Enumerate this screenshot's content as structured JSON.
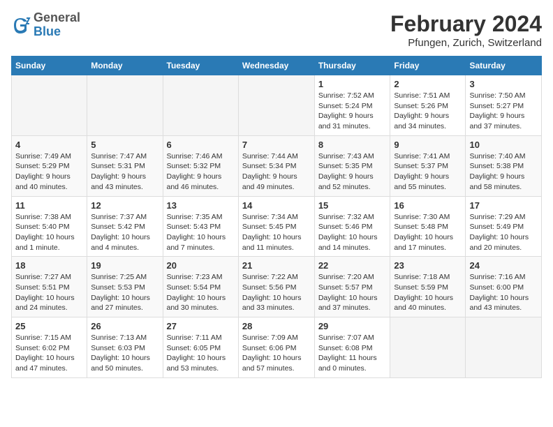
{
  "header": {
    "logo_line1": "General",
    "logo_line2": "Blue",
    "title": "February 2024",
    "subtitle": "Pfungen, Zurich, Switzerland"
  },
  "days_of_week": [
    "Sunday",
    "Monday",
    "Tuesday",
    "Wednesday",
    "Thursday",
    "Friday",
    "Saturday"
  ],
  "weeks": [
    [
      {
        "day": "",
        "sunrise": "",
        "sunset": "",
        "daylight": "",
        "empty": true
      },
      {
        "day": "",
        "sunrise": "",
        "sunset": "",
        "daylight": "",
        "empty": true
      },
      {
        "day": "",
        "sunrise": "",
        "sunset": "",
        "daylight": "",
        "empty": true
      },
      {
        "day": "",
        "sunrise": "",
        "sunset": "",
        "daylight": "",
        "empty": true
      },
      {
        "day": "1",
        "sunrise": "Sunrise: 7:52 AM",
        "sunset": "Sunset: 5:24 PM",
        "daylight": "Daylight: 9 hours and 31 minutes."
      },
      {
        "day": "2",
        "sunrise": "Sunrise: 7:51 AM",
        "sunset": "Sunset: 5:26 PM",
        "daylight": "Daylight: 9 hours and 34 minutes."
      },
      {
        "day": "3",
        "sunrise": "Sunrise: 7:50 AM",
        "sunset": "Sunset: 5:27 PM",
        "daylight": "Daylight: 9 hours and 37 minutes."
      }
    ],
    [
      {
        "day": "4",
        "sunrise": "Sunrise: 7:49 AM",
        "sunset": "Sunset: 5:29 PM",
        "daylight": "Daylight: 9 hours and 40 minutes."
      },
      {
        "day": "5",
        "sunrise": "Sunrise: 7:47 AM",
        "sunset": "Sunset: 5:31 PM",
        "daylight": "Daylight: 9 hours and 43 minutes."
      },
      {
        "day": "6",
        "sunrise": "Sunrise: 7:46 AM",
        "sunset": "Sunset: 5:32 PM",
        "daylight": "Daylight: 9 hours and 46 minutes."
      },
      {
        "day": "7",
        "sunrise": "Sunrise: 7:44 AM",
        "sunset": "Sunset: 5:34 PM",
        "daylight": "Daylight: 9 hours and 49 minutes."
      },
      {
        "day": "8",
        "sunrise": "Sunrise: 7:43 AM",
        "sunset": "Sunset: 5:35 PM",
        "daylight": "Daylight: 9 hours and 52 minutes."
      },
      {
        "day": "9",
        "sunrise": "Sunrise: 7:41 AM",
        "sunset": "Sunset: 5:37 PM",
        "daylight": "Daylight: 9 hours and 55 minutes."
      },
      {
        "day": "10",
        "sunrise": "Sunrise: 7:40 AM",
        "sunset": "Sunset: 5:38 PM",
        "daylight": "Daylight: 9 hours and 58 minutes."
      }
    ],
    [
      {
        "day": "11",
        "sunrise": "Sunrise: 7:38 AM",
        "sunset": "Sunset: 5:40 PM",
        "daylight": "Daylight: 10 hours and 1 minute."
      },
      {
        "day": "12",
        "sunrise": "Sunrise: 7:37 AM",
        "sunset": "Sunset: 5:42 PM",
        "daylight": "Daylight: 10 hours and 4 minutes."
      },
      {
        "day": "13",
        "sunrise": "Sunrise: 7:35 AM",
        "sunset": "Sunset: 5:43 PM",
        "daylight": "Daylight: 10 hours and 7 minutes."
      },
      {
        "day": "14",
        "sunrise": "Sunrise: 7:34 AM",
        "sunset": "Sunset: 5:45 PM",
        "daylight": "Daylight: 10 hours and 11 minutes."
      },
      {
        "day": "15",
        "sunrise": "Sunrise: 7:32 AM",
        "sunset": "Sunset: 5:46 PM",
        "daylight": "Daylight: 10 hours and 14 minutes."
      },
      {
        "day": "16",
        "sunrise": "Sunrise: 7:30 AM",
        "sunset": "Sunset: 5:48 PM",
        "daylight": "Daylight: 10 hours and 17 minutes."
      },
      {
        "day": "17",
        "sunrise": "Sunrise: 7:29 AM",
        "sunset": "Sunset: 5:49 PM",
        "daylight": "Daylight: 10 hours and 20 minutes."
      }
    ],
    [
      {
        "day": "18",
        "sunrise": "Sunrise: 7:27 AM",
        "sunset": "Sunset: 5:51 PM",
        "daylight": "Daylight: 10 hours and 24 minutes."
      },
      {
        "day": "19",
        "sunrise": "Sunrise: 7:25 AM",
        "sunset": "Sunset: 5:53 PM",
        "daylight": "Daylight: 10 hours and 27 minutes."
      },
      {
        "day": "20",
        "sunrise": "Sunrise: 7:23 AM",
        "sunset": "Sunset: 5:54 PM",
        "daylight": "Daylight: 10 hours and 30 minutes."
      },
      {
        "day": "21",
        "sunrise": "Sunrise: 7:22 AM",
        "sunset": "Sunset: 5:56 PM",
        "daylight": "Daylight: 10 hours and 33 minutes."
      },
      {
        "day": "22",
        "sunrise": "Sunrise: 7:20 AM",
        "sunset": "Sunset: 5:57 PM",
        "daylight": "Daylight: 10 hours and 37 minutes."
      },
      {
        "day": "23",
        "sunrise": "Sunrise: 7:18 AM",
        "sunset": "Sunset: 5:59 PM",
        "daylight": "Daylight: 10 hours and 40 minutes."
      },
      {
        "day": "24",
        "sunrise": "Sunrise: 7:16 AM",
        "sunset": "Sunset: 6:00 PM",
        "daylight": "Daylight: 10 hours and 43 minutes."
      }
    ],
    [
      {
        "day": "25",
        "sunrise": "Sunrise: 7:15 AM",
        "sunset": "Sunset: 6:02 PM",
        "daylight": "Daylight: 10 hours and 47 minutes."
      },
      {
        "day": "26",
        "sunrise": "Sunrise: 7:13 AM",
        "sunset": "Sunset: 6:03 PM",
        "daylight": "Daylight: 10 hours and 50 minutes."
      },
      {
        "day": "27",
        "sunrise": "Sunrise: 7:11 AM",
        "sunset": "Sunset: 6:05 PM",
        "daylight": "Daylight: 10 hours and 53 minutes."
      },
      {
        "day": "28",
        "sunrise": "Sunrise: 7:09 AM",
        "sunset": "Sunset: 6:06 PM",
        "daylight": "Daylight: 10 hours and 57 minutes."
      },
      {
        "day": "29",
        "sunrise": "Sunrise: 7:07 AM",
        "sunset": "Sunset: 6:08 PM",
        "daylight": "Daylight: 11 hours and 0 minutes."
      },
      {
        "day": "",
        "sunrise": "",
        "sunset": "",
        "daylight": "",
        "empty": true
      },
      {
        "day": "",
        "sunrise": "",
        "sunset": "",
        "daylight": "",
        "empty": true
      }
    ]
  ]
}
